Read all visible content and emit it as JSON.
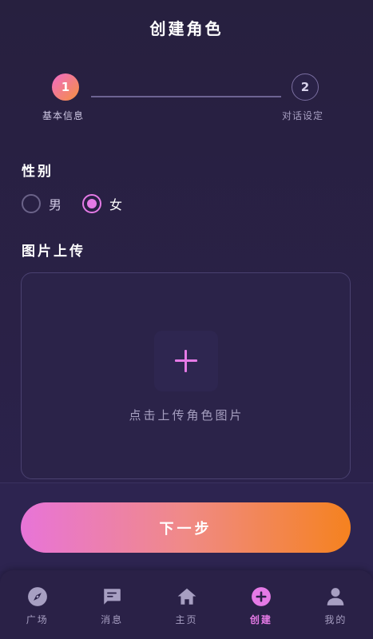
{
  "header": {
    "title": "创建角色"
  },
  "stepper": {
    "steps": [
      {
        "number": "1",
        "label": "基本信息",
        "active": true
      },
      {
        "number": "2",
        "label": "对话设定",
        "active": false
      }
    ]
  },
  "gender": {
    "label": "性别",
    "options": [
      {
        "label": "男",
        "selected": false
      },
      {
        "label": "女",
        "selected": true
      }
    ]
  },
  "upload": {
    "label": "图片上传",
    "hint": "点击上传角色图片",
    "icon": "plus-icon"
  },
  "actions": {
    "next_label": "下一步"
  },
  "tabbar": {
    "items": [
      {
        "label": "广场",
        "icon": "compass-icon",
        "active": false
      },
      {
        "label": "消息",
        "icon": "chat-bubble-icon",
        "active": false
      },
      {
        "label": "主页",
        "icon": "home-icon",
        "active": false
      },
      {
        "label": "创建",
        "icon": "plus-circle-icon",
        "active": true
      },
      {
        "label": "我的",
        "icon": "person-icon",
        "active": false
      }
    ]
  },
  "colors": {
    "background": "#27203f",
    "accent_pink": "#e57ae6",
    "accent_orange": "#f5821f",
    "muted_text": "#a79fc2"
  }
}
